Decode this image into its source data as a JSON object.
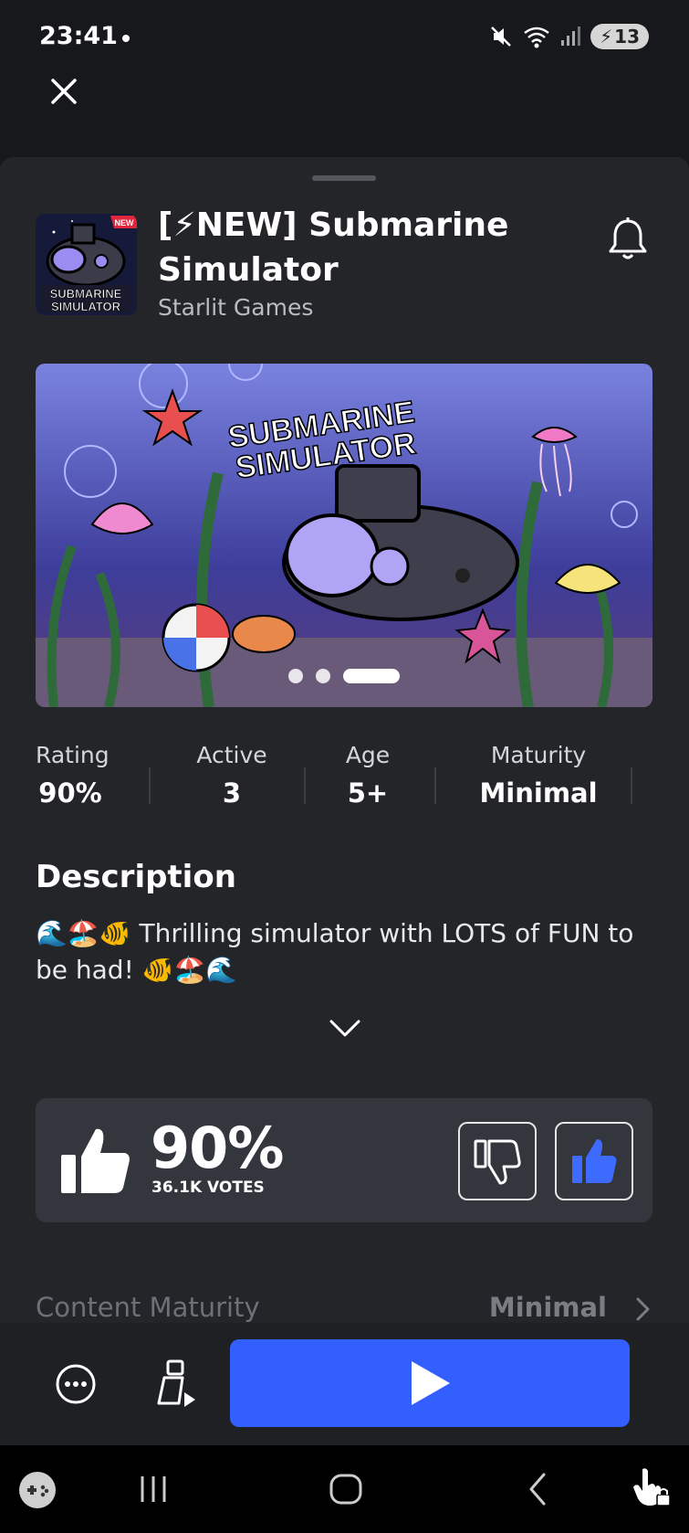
{
  "status_bar": {
    "time": "23:41",
    "battery": "13"
  },
  "game": {
    "title": "[⚡NEW] Submarine Simulator",
    "developer": "Starlit Games",
    "icon_badge": "NEW",
    "icon_text_line1": "SUBMARINE",
    "icon_text_line2": "SIMULATOR"
  },
  "hero": {
    "logo_line1": "SUBMARINE",
    "logo_line2": "SIMULATOR",
    "page_count": 3,
    "active_page": 3
  },
  "stats": [
    {
      "label": "Rating",
      "value": "90%"
    },
    {
      "label": "Active",
      "value": "3"
    },
    {
      "label": "Age",
      "value": "5+"
    },
    {
      "label": "Maturity",
      "value": "Minimal"
    }
  ],
  "description": {
    "heading": "Description",
    "text": "🌊🏖️🐠 Thrilling simulator with LOTS of FUN to be had! 🐠🏖️🌊"
  },
  "votes": {
    "percent": "90%",
    "count": "36.1K VOTES",
    "upvoted": true
  },
  "content_maturity": {
    "label": "Content Maturity",
    "value": "Minimal"
  },
  "colors": {
    "accent": "#335fff",
    "sheet": "#232529",
    "background": "#17181c"
  }
}
